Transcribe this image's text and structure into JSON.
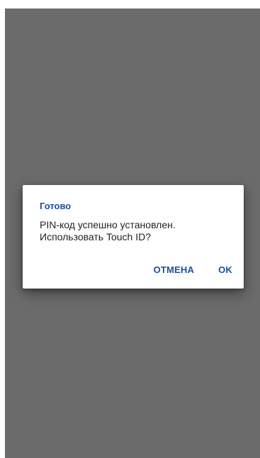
{
  "dialog": {
    "title": "Готово",
    "message_line1": "PIN-код успешно установлен.",
    "message_line2": "Использовать Touch ID?",
    "cancel_label": "ОТМЕНА",
    "ok_label": "OK"
  },
  "colors": {
    "accent": "#1a4f9c",
    "scrim": "#6b6b6b",
    "dialog_bg": "#ffffff"
  }
}
